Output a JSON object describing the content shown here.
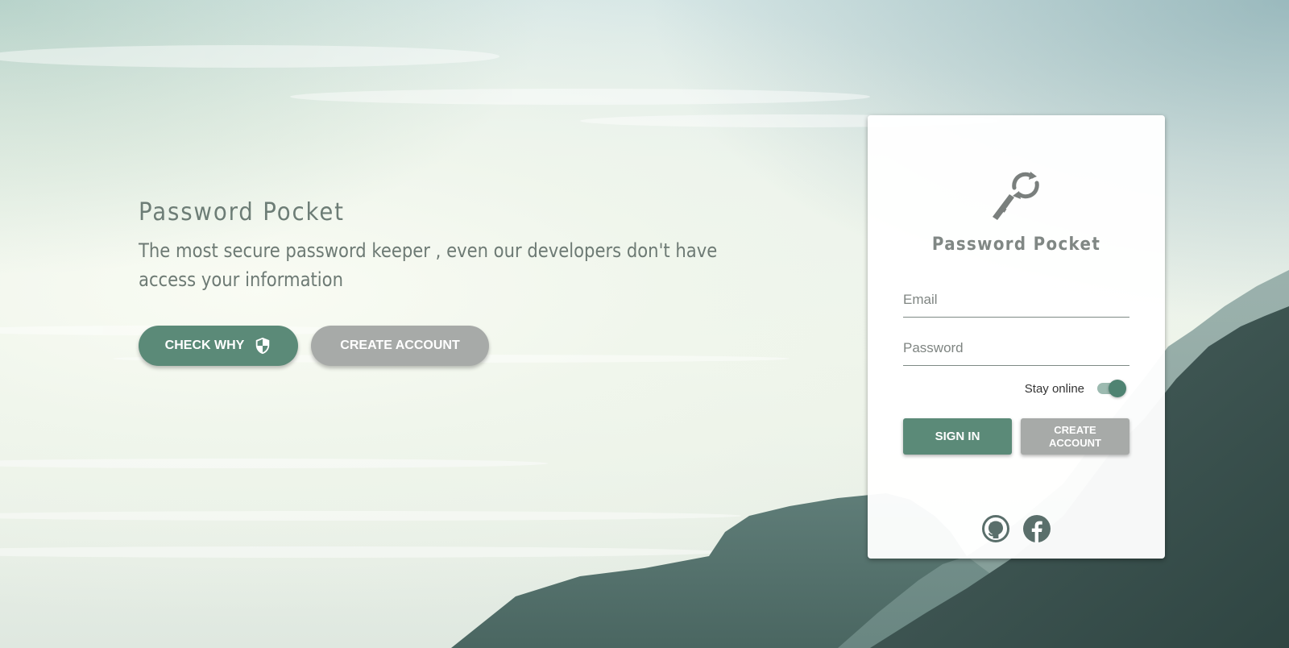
{
  "hero": {
    "title": "Password Pocket",
    "subtitle": "The most secure password keeper , even our developers don't have access your information",
    "check_why_label": "CHECK WHY",
    "create_account_label": "CREATE ACCOUNT"
  },
  "login_card": {
    "title": "Password Pocket",
    "email_placeholder": "Email",
    "password_placeholder": "Password",
    "stay_online_label": "Stay online",
    "stay_online_enabled": true,
    "sign_in_label": "SIGN IN",
    "create_account_label": "CREATE ACCOUNT",
    "social_icons": [
      "github-icon",
      "facebook-icon"
    ]
  },
  "colors": {
    "primary": "#5b8a78",
    "secondary": "#a7aaa8",
    "title_text": "#6d7d76"
  }
}
